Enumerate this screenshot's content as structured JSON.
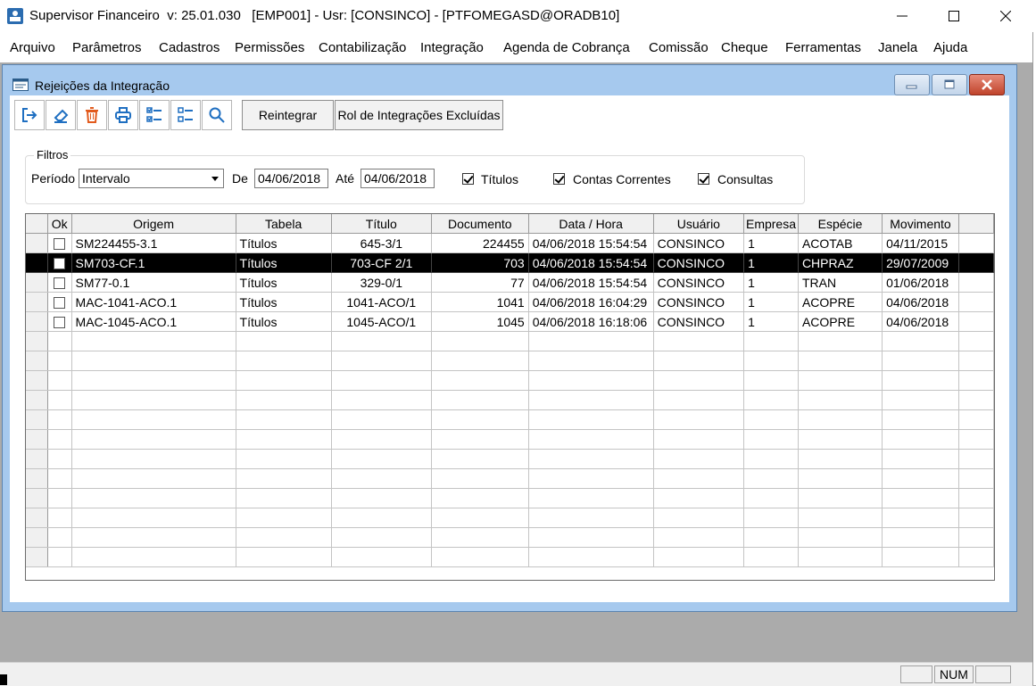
{
  "window": {
    "title": "Supervisor Financeiro  v: 25.01.030   [EMP001] - Usr: [CONSINCO] - [PTFOMEGASD@ORADB10]"
  },
  "menu": [
    "Arquivo",
    "Parâmetros",
    "Cadastros",
    "Permissões",
    "Contabilização",
    "Integração",
    "Agenda de Cobrança",
    "Comissão",
    "Cheque",
    "Ferramentas",
    "Janela",
    "Ajuda"
  ],
  "child": {
    "title": "Rejeições da Integração"
  },
  "toolbar": {
    "icons": [
      "exit-icon",
      "eraser-icon",
      "trash-icon",
      "print-icon",
      "check-list-icon",
      "uncheck-list-icon",
      "search-icon"
    ],
    "reintegrar_label": "Reintegrar",
    "rol_label": "Rol de Integrações Excluídas"
  },
  "filters": {
    "legend": "Filtros",
    "periodo_label": "Período",
    "periodo_value": "Intervalo",
    "de_label": "De",
    "de_value": "04/06/2018",
    "ate_label": "Até",
    "ate_value": "04/06/2018",
    "titulos_label": "Títulos",
    "titulos_checked": true,
    "contas_label": "Contas Correntes",
    "contas_checked": true,
    "consultas_label": "Consultas",
    "consultas_checked": true
  },
  "grid": {
    "columns": [
      "Ok",
      "Origem",
      "Tabela",
      "Título",
      "Documento",
      "Data / Hora",
      "Usuário",
      "Empresa",
      "Espécie",
      "Movimento"
    ],
    "rows": [
      {
        "origem": "SM224455-3.1",
        "tabela": "Títulos",
        "titulo": "645-3/1",
        "documento": "224455",
        "datahora": "04/06/2018 15:54:54",
        "usuario": "CONSINCO",
        "empresa": "1",
        "especie": "ACOTAB",
        "movimento": "04/11/2015"
      },
      {
        "origem": "SM703-CF.1",
        "tabela": "Títulos",
        "titulo": "703-CF 2/1",
        "documento": "703",
        "datahora": "04/06/2018 15:54:54",
        "usuario": "CONSINCO",
        "empresa": "1",
        "especie": "CHPRAZ",
        "movimento": "29/07/2009"
      },
      {
        "origem": "SM77-0.1",
        "tabela": "Títulos",
        "titulo": "329-0/1",
        "documento": "77",
        "datahora": "04/06/2018 15:54:54",
        "usuario": "CONSINCO",
        "empresa": "1",
        "especie": "TRAN",
        "movimento": "01/06/2018"
      },
      {
        "origem": "MAC-1041-ACO.1",
        "tabela": "Títulos",
        "titulo": "1041-ACO/1",
        "documento": "1041",
        "datahora": "04/06/2018 16:04:29",
        "usuario": "CONSINCO",
        "empresa": "1",
        "especie": "ACOPRE",
        "movimento": "04/06/2018"
      },
      {
        "origem": "MAC-1045-ACO.1",
        "tabela": "Títulos",
        "titulo": "1045-ACO/1",
        "documento": "1045",
        "datahora": "04/06/2018 16:18:06",
        "usuario": "CONSINCO",
        "empresa": "1",
        "especie": "ACOPRE",
        "movimento": "04/06/2018"
      }
    ],
    "selected_row": 1
  },
  "status": {
    "num": "NUM"
  }
}
